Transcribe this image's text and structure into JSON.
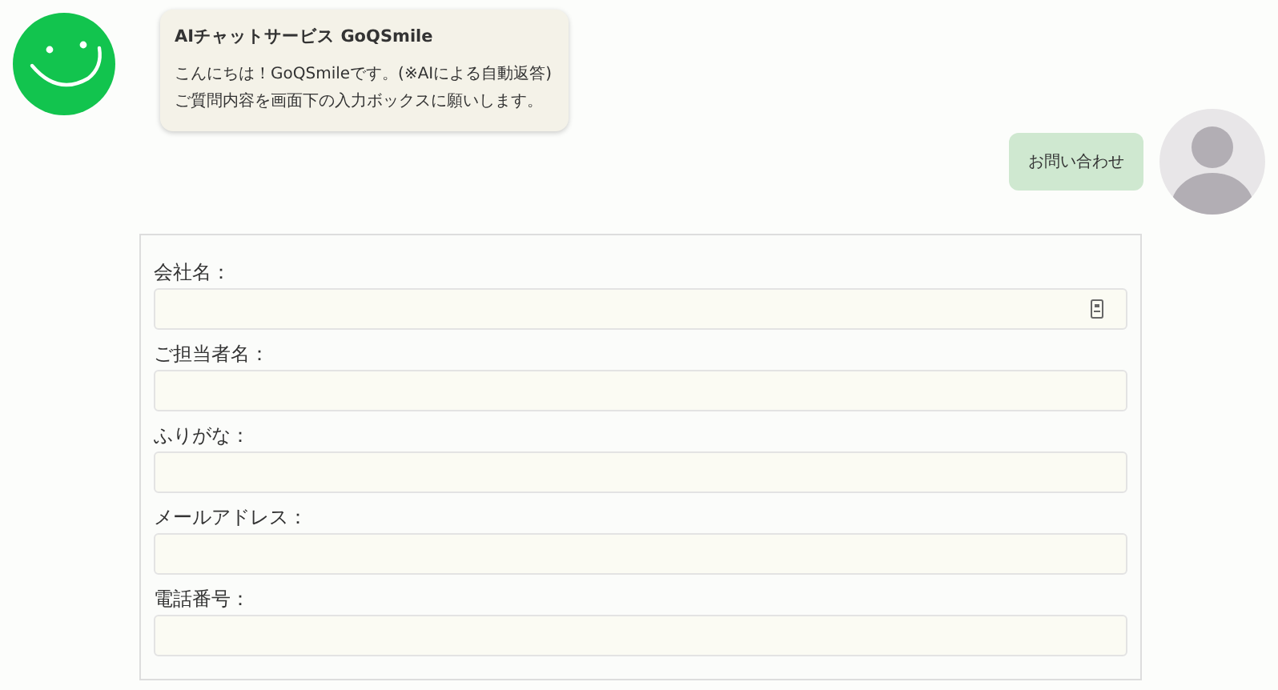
{
  "bot_message": {
    "title": "AIチャットサービス GoQSmile",
    "lines": [
      "こんにちは！GoQSmileです。(※AIによる自動返答)",
      "ご質問内容を画面下の入力ボックスに願いします。"
    ]
  },
  "user_message": {
    "text": "お問い合わせ"
  },
  "form": {
    "fields": [
      {
        "label": "会社名：",
        "autofill_icon": true
      },
      {
        "label": "ご担当者名：",
        "autofill_icon": false
      },
      {
        "label": "ふりがな：",
        "autofill_icon": false
      },
      {
        "label": "メールアドレス：",
        "autofill_icon": false
      },
      {
        "label": "電話番号：",
        "autofill_icon": false
      }
    ]
  }
}
